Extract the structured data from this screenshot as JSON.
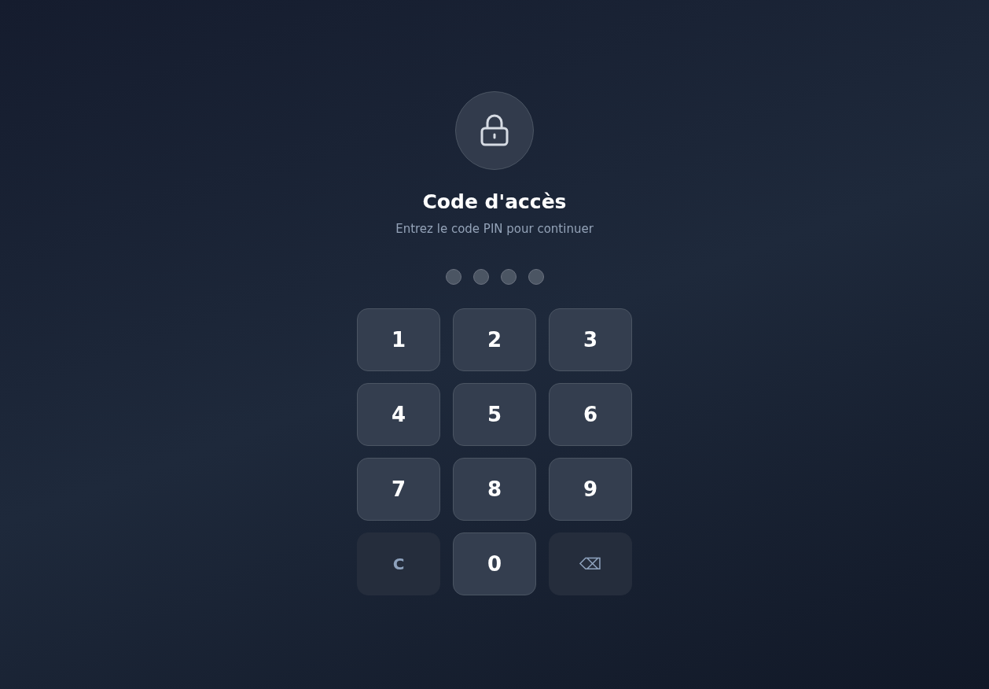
{
  "title": "Code d'accès",
  "subtitle": "Entrez le code PIN pour continuer",
  "pin_dots": [
    {
      "filled": false
    },
    {
      "filled": false
    },
    {
      "filled": false
    },
    {
      "filled": false
    }
  ],
  "keys": [
    {
      "label": "1",
      "kind": "digit"
    },
    {
      "label": "2",
      "kind": "digit"
    },
    {
      "label": "3",
      "kind": "digit"
    },
    {
      "label": "4",
      "kind": "digit"
    },
    {
      "label": "5",
      "kind": "digit"
    },
    {
      "label": "6",
      "kind": "digit"
    },
    {
      "label": "7",
      "kind": "digit"
    },
    {
      "label": "8",
      "kind": "digit"
    },
    {
      "label": "9",
      "kind": "digit"
    },
    {
      "label": "C",
      "kind": "clear"
    },
    {
      "label": "0",
      "kind": "digit"
    },
    {
      "label": "⌫",
      "kind": "backspace"
    }
  ]
}
